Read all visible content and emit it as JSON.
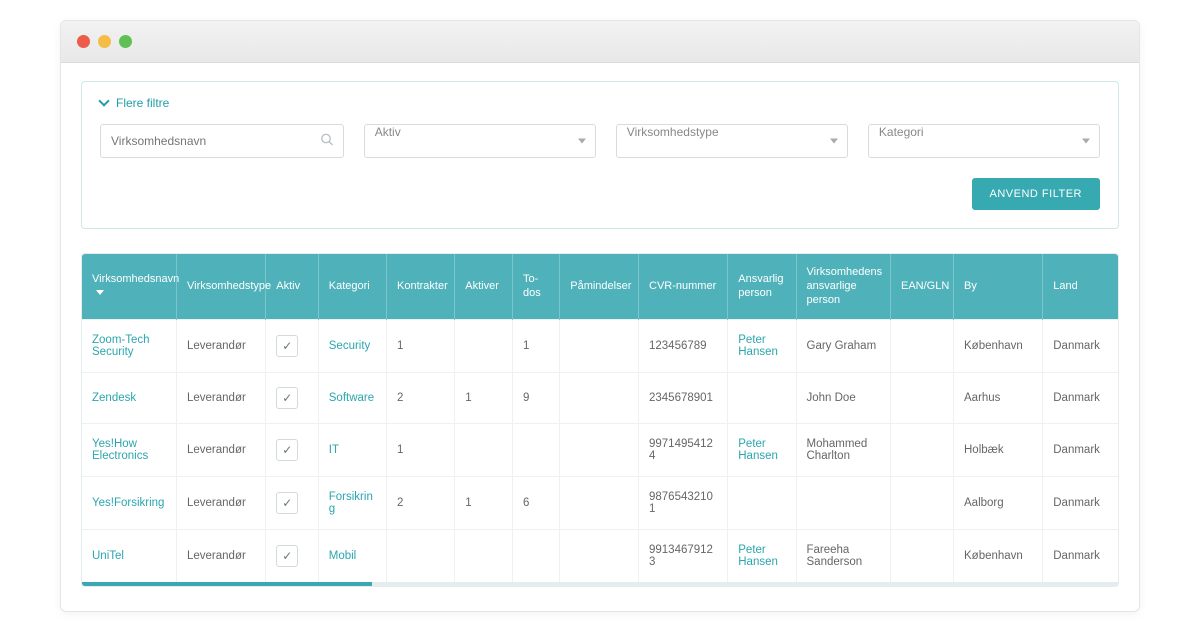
{
  "filters": {
    "title": "Flere filtre",
    "company_placeholder": "Virksomhedsnavn",
    "aktiv_label": "Aktiv",
    "type_label": "Virksomhedstype",
    "kategori_label": "Kategori",
    "apply_label": "ANVEND FILTER"
  },
  "columns": {
    "name": "Virksomhedsnavn",
    "type": "Virksomhedstype",
    "aktiv": "Aktiv",
    "kategori": "Kategori",
    "kontrakter": "Kontrakter",
    "aktiver": "Aktiver",
    "todos": "To-dos",
    "paamindelser": "Påmindelser",
    "cvr": "CVR-nummer",
    "ansvarlig": "Ansvarlig person",
    "virk_ansv": "Virksomhedens ansvarlige person",
    "ean": "EAN/GLN",
    "by": "By",
    "land": "Land"
  },
  "rows": [
    {
      "name": "Zoom-Tech Security",
      "type": "Leverandør",
      "kategori": "Security",
      "kontrakter": "1",
      "aktiver": "",
      "todos": "1",
      "paamindelser": "",
      "cvr": "123456789",
      "ansvarlig": "Peter Hansen",
      "virk_ansv": "Gary Graham",
      "ean": "",
      "by": "København",
      "land": "Danmark"
    },
    {
      "name": "Zendesk",
      "type": "Leverandør",
      "kategori": "Software",
      "kontrakter": "2",
      "aktiver": "1",
      "todos": "9",
      "paamindelser": "",
      "cvr": "2345678901",
      "ansvarlig": "",
      "virk_ansv": "John Doe",
      "ean": "",
      "by": "Aarhus",
      "land": "Danmark"
    },
    {
      "name": "Yes!How Electronics",
      "type": "Leverandør",
      "kategori": "IT",
      "kontrakter": "1",
      "aktiver": "",
      "todos": "",
      "paamindelser": "",
      "cvr": "99714954124",
      "ansvarlig": "Peter Hansen",
      "virk_ansv": "Mohammed Charlton",
      "ean": "",
      "by": "Holbæk",
      "land": "Danmark"
    },
    {
      "name": "Yes!Forsikring",
      "type": "Leverandør",
      "kategori": "Forsikring",
      "kontrakter": "2",
      "aktiver": "1",
      "todos": "6",
      "paamindelser": "",
      "cvr": "98765432101",
      "ansvarlig": "",
      "virk_ansv": "",
      "ean": "",
      "by": "Aalborg",
      "land": "Danmark"
    },
    {
      "name": "UniTel",
      "type": "Leverandør",
      "kategori": "Mobil",
      "kontrakter": "",
      "aktiver": "",
      "todos": "",
      "paamindelser": "",
      "cvr": "99134679123",
      "ansvarlig": "Peter Hansen",
      "virk_ansv": "Fareeha Sanderson",
      "ean": "",
      "by": "København",
      "land": "Danmark"
    }
  ]
}
